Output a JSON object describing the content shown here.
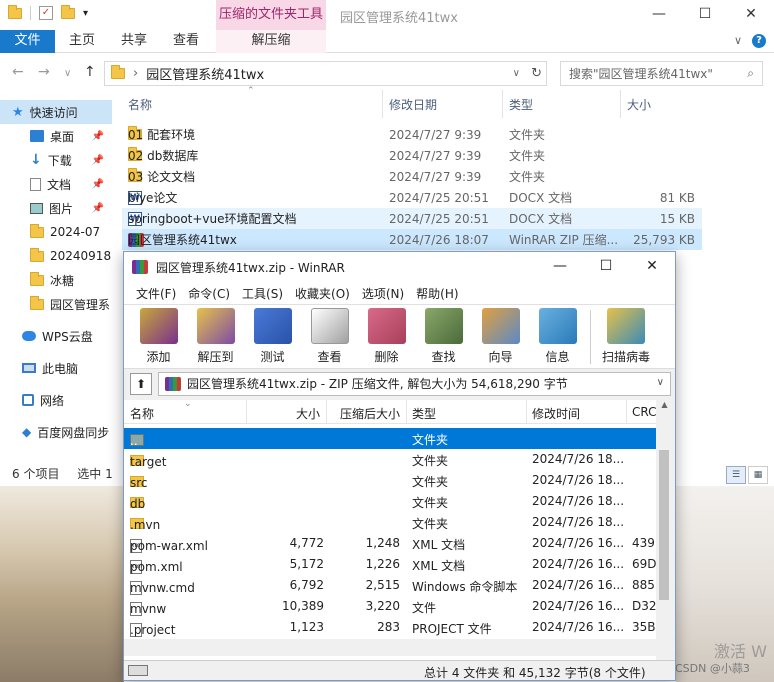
{
  "explorer": {
    "context_tab": "压缩的文件夹工具",
    "title": "园区管理系统41twx",
    "window_buttons": {
      "min": "—",
      "max": "☐",
      "close": "✕"
    },
    "tabs": [
      {
        "label": "文件"
      },
      {
        "label": "主页"
      },
      {
        "label": "共享"
      },
      {
        "label": "查看"
      },
      {
        "label": "解压缩"
      }
    ],
    "address": {
      "crumb": "园区管理系统41twx",
      "refresh": "↻"
    },
    "search": {
      "placeholder": "搜索\"园区管理系统41twx\""
    },
    "nav": {
      "back": "←",
      "forward": "→",
      "recent": "∨",
      "up": "↑"
    },
    "sidebar": [
      {
        "label": "快速访问",
        "icon": "star-icon",
        "selected": true
      },
      {
        "label": "桌面",
        "icon": "desktop-icon",
        "pinned": true
      },
      {
        "label": "下载",
        "icon": "download-icon",
        "pinned": true
      },
      {
        "label": "文档",
        "icon": "document-icon",
        "pinned": true
      },
      {
        "label": "图片",
        "icon": "picture-icon",
        "pinned": true
      },
      {
        "label": "2024-07",
        "icon": "folder-icon"
      },
      {
        "label": "20240918",
        "icon": "folder-icon"
      },
      {
        "label": "冰糖",
        "icon": "folder-icon"
      },
      {
        "label": "园区管理系",
        "icon": "folder-icon"
      },
      {
        "label": "WPS云盘",
        "icon": "cloud-icon"
      },
      {
        "label": "此电脑",
        "icon": "pc-icon"
      },
      {
        "label": "网络",
        "icon": "network-icon"
      },
      {
        "label": "百度网盘同步",
        "icon": "baidu-icon"
      }
    ],
    "columns": {
      "name": "名称",
      "date": "修改日期",
      "type": "类型",
      "size": "大小"
    },
    "files": [
      {
        "name": "01 配套环境",
        "date": "2024/7/27 9:39",
        "type": "文件夹",
        "size": "",
        "icon": "folder-icon"
      },
      {
        "name": "02 db数据库",
        "date": "2024/7/27 9:39",
        "type": "文件夹",
        "size": "",
        "icon": "folder-icon"
      },
      {
        "name": "03 论文文档",
        "date": "2024/7/27 9:39",
        "type": "文件夹",
        "size": "",
        "icon": "folder-icon"
      },
      {
        "name": "biye论文",
        "date": "2024/7/25 20:51",
        "type": "DOCX 文档",
        "size": "81 KB",
        "icon": "word-icon"
      },
      {
        "name": "springboot+vue环境配置文档",
        "date": "2024/7/25 20:51",
        "type": "DOCX 文档",
        "size": "15 KB",
        "icon": "word-icon"
      },
      {
        "name": "园区管理系统41twx",
        "date": "2024/7/26 18:07",
        "type": "WinRAR ZIP 压缩...",
        "size": "25,793 KB",
        "icon": "winrar-icon"
      }
    ],
    "status": {
      "count": "6 个项目",
      "selected": "选中 1"
    }
  },
  "winrar": {
    "title": "园区管理系统41twx.zip - WinRAR",
    "menu": [
      "文件(F)",
      "命令(C)",
      "工具(S)",
      "收藏夹(O)",
      "选项(N)",
      "帮助(H)"
    ],
    "toolbar": [
      {
        "label": "添加",
        "color": "#c8a83a"
      },
      {
        "label": "解压到",
        "color": "#7d4aa8"
      },
      {
        "label": "测试",
        "color": "#2a52a8"
      },
      {
        "label": "查看",
        "color": "#a0a0a0"
      },
      {
        "label": "删除",
        "color": "#a8405a"
      },
      {
        "label": "查找",
        "color": "#4a6a3a"
      },
      {
        "label": "向导",
        "color": "#5a8ac8"
      },
      {
        "label": "信息",
        "color": "#2a7ab8"
      },
      {
        "label": "扫描病毒",
        "color": "#3a8ab8"
      }
    ],
    "path": "园区管理系统41twx.zip - ZIP 压缩文件, 解包大小为 54,618,290 字节",
    "columns": {
      "name": "名称",
      "size": "大小",
      "packed": "压缩后大小",
      "type": "类型",
      "modified": "修改时间",
      "crc": "CRC"
    },
    "rows": [
      {
        "name": "..",
        "size": "",
        "packed": "",
        "type": "文件夹",
        "modified": "",
        "crc": "",
        "icon": "up-folder-icon",
        "selected": true
      },
      {
        "name": "target",
        "size": "",
        "packed": "",
        "type": "文件夹",
        "modified": "2024/7/26 18...",
        "crc": "",
        "icon": "folder-icon"
      },
      {
        "name": "src",
        "size": "",
        "packed": "",
        "type": "文件夹",
        "modified": "2024/7/26 18...",
        "crc": "",
        "icon": "folder-icon"
      },
      {
        "name": "db",
        "size": "",
        "packed": "",
        "type": "文件夹",
        "modified": "2024/7/26 18...",
        "crc": "",
        "icon": "folder-icon"
      },
      {
        "name": ".mvn",
        "size": "",
        "packed": "",
        "type": "文件夹",
        "modified": "2024/7/26 18...",
        "crc": "",
        "icon": "folder-icon"
      },
      {
        "name": "pom-war.xml",
        "size": "4,772",
        "packed": "1,248",
        "type": "XML 文档",
        "modified": "2024/7/26 16...",
        "crc": "439",
        "icon": "xml-icon"
      },
      {
        "name": "pom.xml",
        "size": "5,172",
        "packed": "1,226",
        "type": "XML 文档",
        "modified": "2024/7/26 16...",
        "crc": "69D",
        "icon": "xml-icon"
      },
      {
        "name": "mvnw.cmd",
        "size": "6,792",
        "packed": "2,515",
        "type": "Windows 命令脚本",
        "modified": "2024/7/26 16...",
        "crc": "885",
        "icon": "cmd-icon"
      },
      {
        "name": "mvnw",
        "size": "10,389",
        "packed": "3,220",
        "type": "文件",
        "modified": "2024/7/26 16...",
        "crc": "D32",
        "icon": "file-icon"
      },
      {
        "name": ".project",
        "size": "1,123",
        "packed": "283",
        "type": "PROJECT 文件",
        "modified": "2024/7/26 16...",
        "crc": "35B",
        "icon": "file-icon"
      }
    ],
    "status": "总计 4 文件夹 和 45,132 字节(8 个文件)"
  },
  "watermark": {
    "activate": "激活 W",
    "csdn": "CSDN @小蒜3"
  }
}
